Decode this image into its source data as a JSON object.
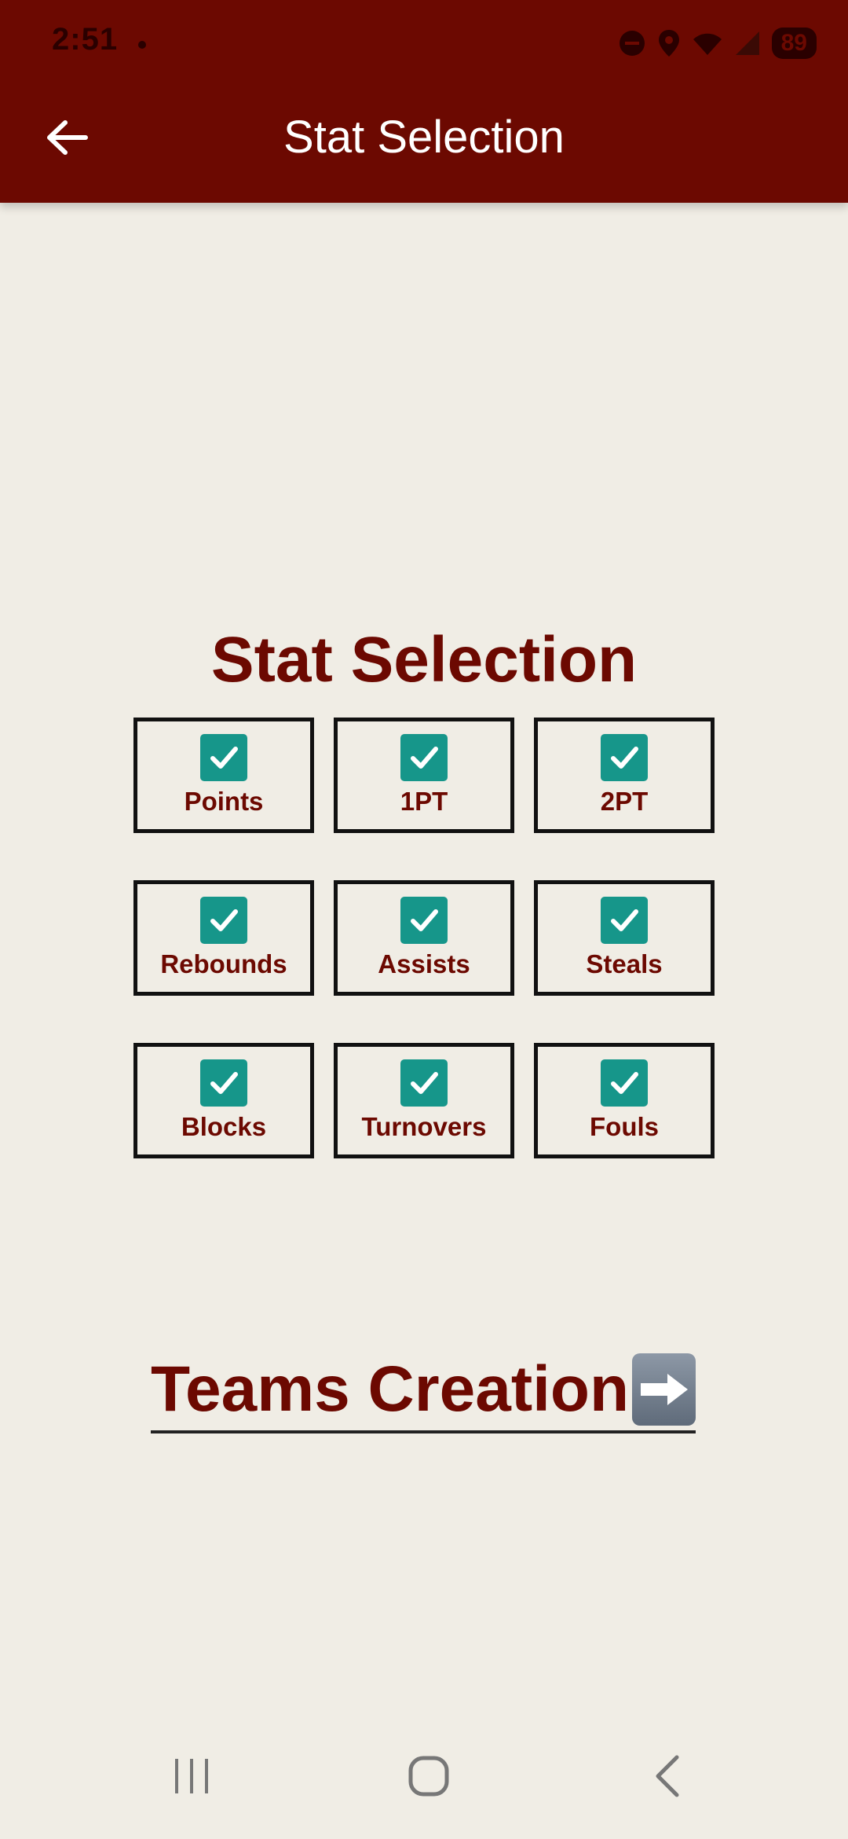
{
  "status_bar": {
    "time": "2:51",
    "battery": "89"
  },
  "app_bar": {
    "title": "Stat Selection"
  },
  "main": {
    "heading": "Stat Selection",
    "stats": [
      {
        "label": "Points",
        "checked": true
      },
      {
        "label": "1PT",
        "checked": true
      },
      {
        "label": "2PT",
        "checked": true
      },
      {
        "label": "Rebounds",
        "checked": true
      },
      {
        "label": "Assists",
        "checked": true
      },
      {
        "label": "Steals",
        "checked": true
      },
      {
        "label": "Blocks",
        "checked": true
      },
      {
        "label": "Turnovers",
        "checked": true
      },
      {
        "label": "Fouls",
        "checked": true
      }
    ],
    "next_link": "Teams Creation"
  },
  "icons": {
    "back": "arrow-left-icon",
    "check": "checkmark-icon",
    "next_arrow": "right-arrow-emoji-icon",
    "nav_recents": "recents-icon",
    "nav_home": "home-icon",
    "nav_back": "back-chevron-icon"
  },
  "colors": {
    "primary": "#6c0901",
    "background": "#f0ede5",
    "checkbox": "#16968a"
  }
}
